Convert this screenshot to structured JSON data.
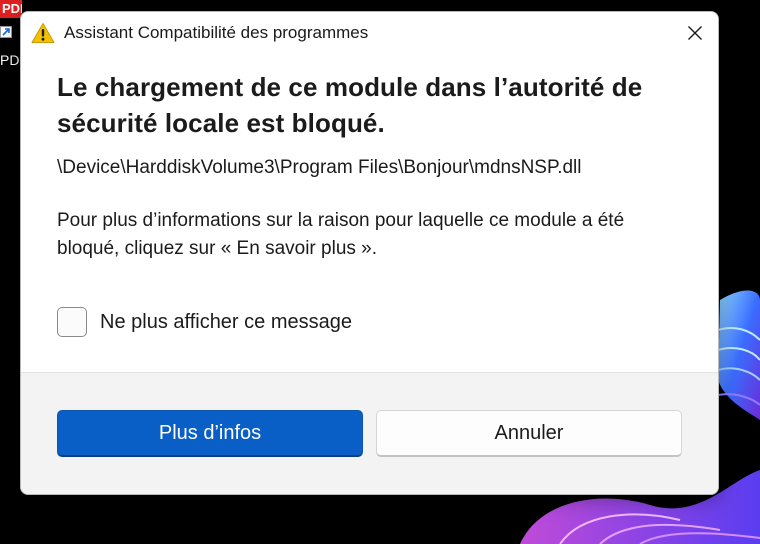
{
  "desktop": {
    "shortcut_tile_text": "PDF",
    "shortcut_label": "PD"
  },
  "dialog": {
    "title": "Assistant Compatibilité des programmes",
    "heading": "Le chargement de ce module dans l’autorité de sécurité locale est bloqué.",
    "module_path": "\\Device\\HarddiskVolume3\\Program Files\\Bonjour\\mdnsNSP.dll",
    "description": "Pour plus d’informations sur la raison pour laquelle ce module a été bloqué, cliquez sur « En savoir plus ».",
    "checkbox_label": "Ne plus afficher ce message",
    "checkbox_checked": false,
    "primary_button": "Plus d’infos",
    "secondary_button": "Annuler"
  },
  "colors": {
    "accent": "#0a5fc6",
    "warning": "#f2c200"
  }
}
